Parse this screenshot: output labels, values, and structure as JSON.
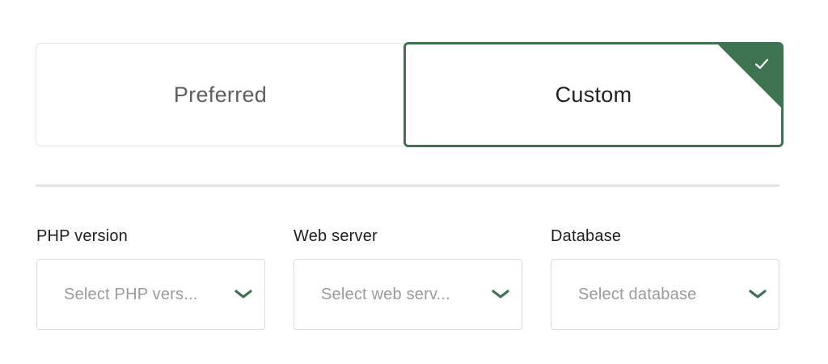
{
  "options": {
    "preferred_label": "Preferred",
    "custom_label": "Custom",
    "selected": "Custom"
  },
  "fields": {
    "php": {
      "label": "PHP version",
      "placeholder": "Select PHP vers..."
    },
    "webserver": {
      "label": "Web server",
      "placeholder": "Select web serv..."
    },
    "database": {
      "label": "Database",
      "placeholder": "Select database"
    }
  },
  "icons": {
    "check": "check-icon",
    "chevron": "chevron-down-icon"
  },
  "colors": {
    "accent": "#3d7350",
    "border": "#e2e2e2",
    "placeholder": "#9a9a9a",
    "divider": "#e6e6e6"
  }
}
